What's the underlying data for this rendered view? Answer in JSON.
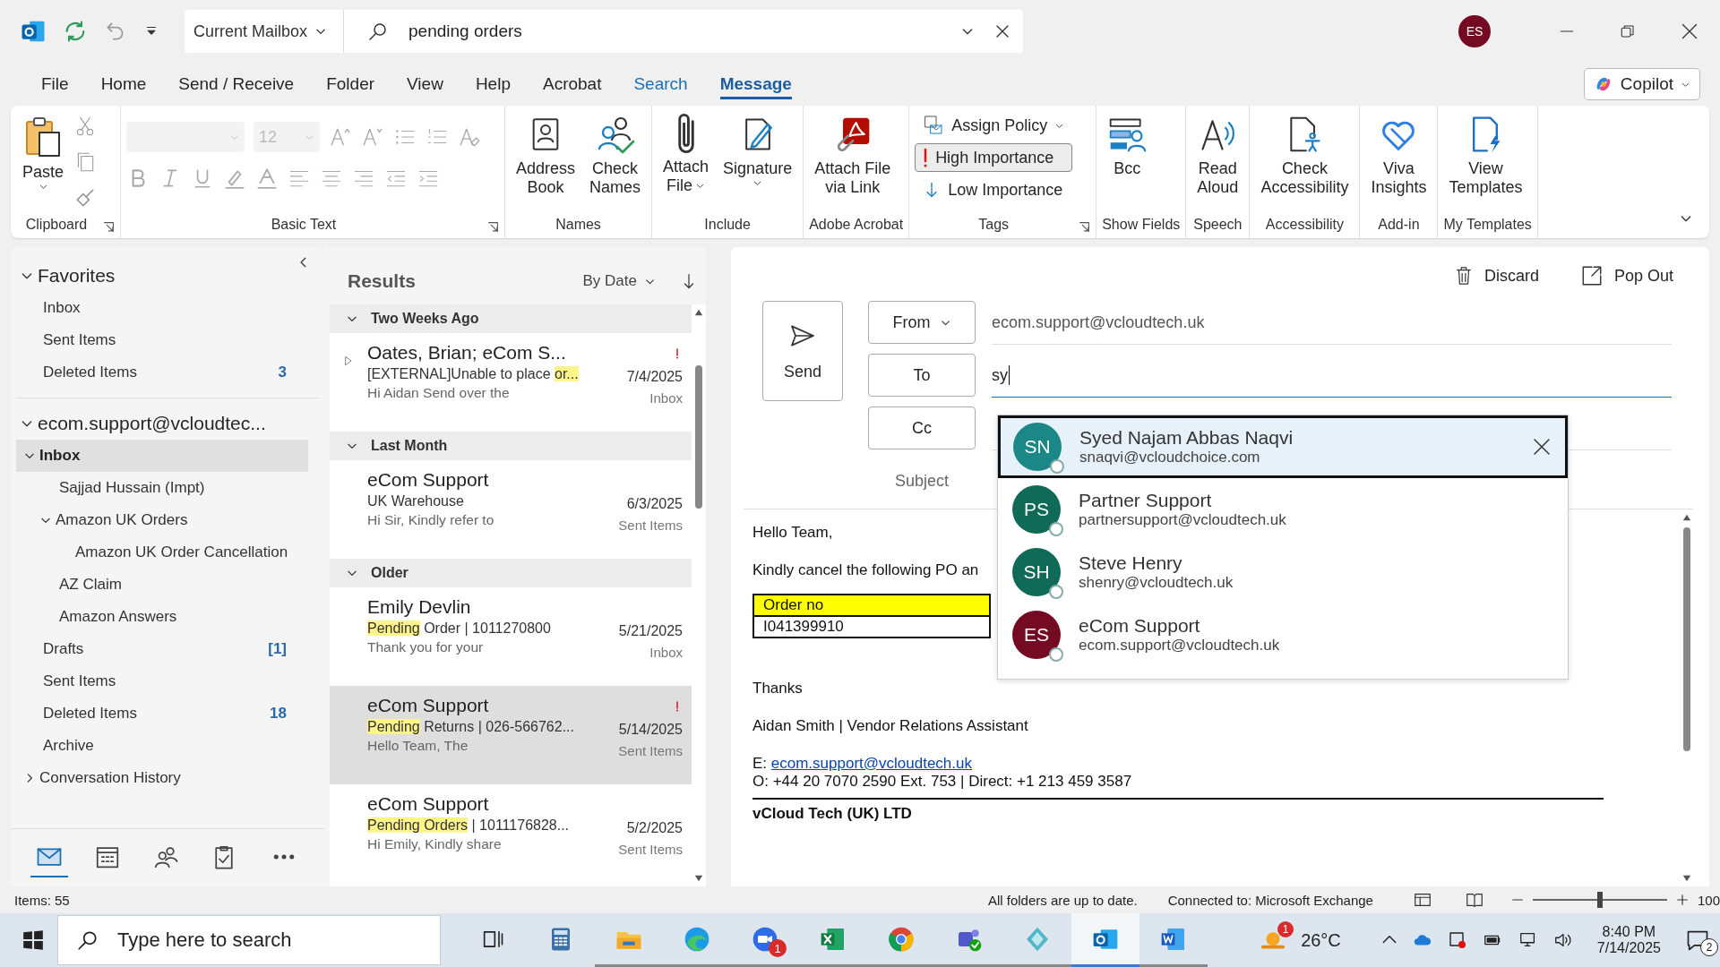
{
  "title_bar": {
    "scope": "Current Mailbox",
    "search": "pending orders",
    "avatar": "ES"
  },
  "menu_tabs": [
    {
      "label": "File",
      "selected": false,
      "kind": "plain"
    },
    {
      "label": "Home",
      "selected": false,
      "kind": "plain"
    },
    {
      "label": "Send / Receive",
      "selected": false,
      "kind": "plain"
    },
    {
      "label": "Folder",
      "selected": false,
      "kind": "plain"
    },
    {
      "label": "View",
      "selected": false,
      "kind": "plain"
    },
    {
      "label": "Help",
      "selected": false,
      "kind": "plain"
    },
    {
      "label": "Acrobat",
      "selected": false,
      "kind": "plain"
    },
    {
      "label": "Search",
      "selected": false,
      "kind": "contextual"
    },
    {
      "label": "Message",
      "selected": true,
      "kind": "plain"
    }
  ],
  "copilot": "Copilot",
  "ribbon": {
    "groups": [
      {
        "kind": "clipboard",
        "label": "Clipboard",
        "launcher": true,
        "items": [
          {
            "label": "Paste",
            "menu": true
          }
        ]
      },
      {
        "kind": "basic-text",
        "label": "Basic Text",
        "launcher": true,
        "font_size": "12",
        "disabled": true
      },
      {
        "kind": "buttons",
        "label": "Names",
        "items": [
          {
            "label": "Address\nBook",
            "menu": false
          },
          {
            "label": "Check\nNames",
            "menu": false
          }
        ]
      },
      {
        "kind": "buttons",
        "label": "Include",
        "items": [
          {
            "label": "Attach\nFile",
            "menu": true
          },
          {
            "label": "Signature",
            "menu": true
          }
        ]
      },
      {
        "kind": "buttons",
        "label": "Adobe Acrobat",
        "items": [
          {
            "label": "Attach File\nvia Link",
            "menu": false
          }
        ]
      },
      {
        "kind": "tags",
        "label": "Tags",
        "launcher": true,
        "items": [
          {
            "kind": "policy",
            "label": "Assign Policy",
            "menu": true,
            "on": false
          },
          {
            "kind": "high",
            "label": "High Importance",
            "menu": false,
            "on": true
          },
          {
            "kind": "low",
            "label": "Low Importance",
            "menu": false,
            "on": false
          }
        ]
      },
      {
        "kind": "buttons",
        "label": "Show Fields",
        "items": [
          {
            "label": "Bcc",
            "menu": false
          }
        ]
      },
      {
        "kind": "buttons",
        "label": "Speech",
        "items": [
          {
            "label": "Read\nAloud",
            "menu": false
          }
        ]
      },
      {
        "kind": "buttons",
        "label": "Accessibility",
        "items": [
          {
            "label": "Check\nAccessibility",
            "menu": false
          }
        ]
      },
      {
        "kind": "buttons",
        "label": "Add-in",
        "items": [
          {
            "label": "Viva\nInsights",
            "menu": false
          }
        ]
      },
      {
        "kind": "buttons",
        "label": "My Templates",
        "items": [
          {
            "label": "View\nTemplates",
            "menu": false
          }
        ]
      }
    ]
  },
  "folders": {
    "favorites": {
      "label": "Favorites",
      "expanded": true,
      "items": [
        {
          "label": "Inbox",
          "selected": false
        },
        {
          "label": "Sent Items",
          "selected": false
        },
        {
          "label": "Deleted Items",
          "count": "3",
          "selected": false
        }
      ]
    },
    "account": {
      "label": "ecom.support@vcloudtec...",
      "expanded": true,
      "children": [
        {
          "label": "Inbox",
          "selected": true,
          "expanded": true,
          "children": [
            {
              "label": "Sajjad Hussain (Impt)",
              "selected": false
            },
            {
              "label": "Amazon UK Orders",
              "selected": false,
              "expanded": true,
              "children": [
                {
                  "label": "Amazon UK Order Cancellation",
                  "selected": false
                }
              ]
            },
            {
              "label": "AZ Claim",
              "selected": false
            },
            {
              "label": "Amazon Answers",
              "selected": false
            }
          ]
        },
        {
          "label": "Drafts",
          "count": "[1]",
          "selected": false
        },
        {
          "label": "Sent Items",
          "selected": false
        },
        {
          "label": "Deleted Items",
          "count": "18",
          "selected": false
        },
        {
          "label": "Archive",
          "selected": false
        },
        {
          "label": "Conversation History",
          "selected": false,
          "expanded": false
        }
      ]
    }
  },
  "nav": [
    {
      "selected": true
    },
    {
      "selected": false
    },
    {
      "selected": false
    },
    {
      "selected": false
    },
    {
      "selected": false
    }
  ],
  "message_list": {
    "title": "Results",
    "sort": "By Date",
    "groups": [
      {
        "label": "Two Weeks Ago",
        "expanded": true,
        "messages": [
          {
            "sender": "Oates, Brian;  eCom S...",
            "subject": [
              {
                "text": "[EXTERNAL]Unable to place ",
                "hit": false
              },
              {
                "text": "or...",
                "hit": true
              }
            ],
            "preview": "Hi Aidan  Send over the",
            "date": "7/4/2025",
            "folder": "Inbox",
            "important": true,
            "thread": true,
            "selected": false
          }
        ]
      },
      {
        "label": "Last Month",
        "expanded": true,
        "messages": [
          {
            "sender": "eCom Support",
            "subject": [
              {
                "text": "UK Warehouse",
                "hit": false
              }
            ],
            "preview": "Hi Sir,  Kindly refer to",
            "date": "6/3/2025",
            "folder": "Sent Items",
            "important": false,
            "thread": false,
            "selected": false
          }
        ]
      },
      {
        "label": "Older",
        "expanded": true,
        "messages": [
          {
            "sender": "Emily Devlin",
            "subject": [
              {
                "text": "Pending",
                "hit": true
              },
              {
                "text": " Order | 1011270800",
                "hit": false
              }
            ],
            "preview": "Thank you for your",
            "date": "5/21/2025",
            "folder": "Inbox",
            "important": false,
            "thread": false,
            "selected": false
          },
          {
            "sender": "eCom Support",
            "subject": [
              {
                "text": "Pending",
                "hit": true
              },
              {
                "text": " Returns | 026-566762...",
                "hit": false
              }
            ],
            "preview": "Hello Team,  The",
            "date": "5/14/2025",
            "folder": "Sent Items",
            "important": true,
            "thread": false,
            "selected": true
          },
          {
            "sender": "eCom Support",
            "subject": [
              {
                "text": "Pending Orders",
                "hit": true
              },
              {
                "text": " |  1011176828...",
                "hit": false
              }
            ],
            "preview": "Hi Emily,  Kindly share",
            "date": "5/2/2025",
            "folder": "Sent Items",
            "important": false,
            "thread": false,
            "selected": false
          }
        ]
      }
    ]
  },
  "compose": {
    "discard": "Discard",
    "pop_out": "Pop Out",
    "send": "Send",
    "from_button": "From",
    "from_value": "ecom.support@vcloudtech.uk",
    "to_button": "To",
    "to_value": "sy",
    "cc_button": "Cc",
    "subject_label": "Subject",
    "suggestions": [
      {
        "initials": "SN",
        "name": "Syed Najam Abbas Naqvi",
        "email": "snaqvi@vcloudchoice.com",
        "color": "#1b8787",
        "selected": true
      },
      {
        "initials": "PS",
        "name": "Partner Support",
        "email": "partnersupport@vcloudtech.uk",
        "color": "#0f6a58",
        "selected": false
      },
      {
        "initials": "SH",
        "name": "Steve Henry",
        "email": "shenry@vcloudtech.uk",
        "color": "#0f6a58",
        "selected": false
      },
      {
        "initials": "ES",
        "name": "eCom Support",
        "email": "ecom.support@vcloudtech.uk",
        "color": "#750b22",
        "selected": false
      }
    ],
    "greeting": "Hello Team,",
    "intro": "Kindly cancel the following PO an",
    "table_header": "Order no",
    "table_value": "I041399910",
    "thanks": "Thanks",
    "signature": "Aidan Smith | Vendor Relations Assistant",
    "email_prefix": "E: ",
    "email_link": "ecom.support@vcloudtech.uk",
    "phone": "O:  +44 20 7070 2590 Ext. 753 | Direct: +1 213 459 3587",
    "company": "vCloud Tech (UK) LTD"
  },
  "status_bar": {
    "items": "Items: 55",
    "sync": "All folders are up to date.",
    "connection": "Connected to: Microsoft Exchange",
    "zoom": {
      "level": 0.5
    },
    "zoom_text": "100"
  },
  "taskbar": {
    "search": "Type here to search",
    "apps": [
      {
        "selected": false,
        "running": false
      },
      {
        "selected": false,
        "running": false
      },
      {
        "selected": false,
        "running": true
      },
      {
        "selected": false,
        "running": true
      },
      {
        "selected": false,
        "running": true,
        "badge": "1"
      },
      {
        "selected": false,
        "running": true
      },
      {
        "selected": false,
        "running": true
      },
      {
        "selected": false,
        "running": true
      },
      {
        "selected": false,
        "running": true
      },
      {
        "selected": true,
        "running": true
      },
      {
        "selected": false,
        "running": true
      }
    ],
    "weather_badge": "1",
    "temperature": "26°C",
    "time": "8:40 PM",
    "date": "7/14/2025",
    "notifications": "2"
  }
}
